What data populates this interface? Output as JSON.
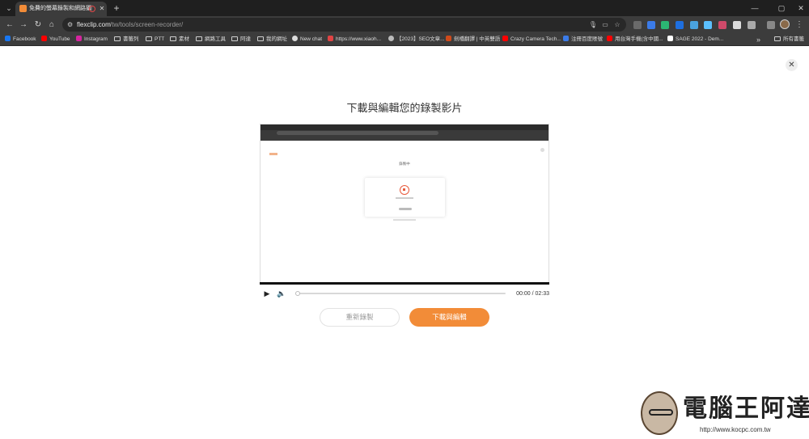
{
  "browser": {
    "tab_title": "免費的螢幕錄製和網路攝影...",
    "tab_close": "✕",
    "new_tab": "+",
    "window_controls": {
      "minimize": "—",
      "maximize": "▢",
      "close": "✕"
    },
    "nav": {
      "back": "←",
      "forward": "→",
      "reload": "↻",
      "home": "⌂"
    },
    "url_host": "flexclip.com",
    "url_path": "/tw/tools/screen-recorder/",
    "omnibox_actions": [
      "mic-icon",
      "cast-icon",
      "star-icon"
    ],
    "menu": "⋮",
    "bookmarks": [
      {
        "label": "Facebook",
        "icon": "facebook-icon",
        "color": "#1877f2"
      },
      {
        "label": "YouTube",
        "icon": "youtube-icon",
        "color": "#ff0000"
      },
      {
        "label": "Instagram",
        "icon": "instagram-icon",
        "color": "#d6249f"
      },
      {
        "label": "書籤列",
        "icon": "folder-icon"
      },
      {
        "label": "PTT",
        "icon": "folder-icon"
      },
      {
        "label": "素材",
        "icon": "folder-icon"
      },
      {
        "label": "網路工具",
        "icon": "folder-icon"
      },
      {
        "label": "阿達",
        "icon": "folder-icon"
      },
      {
        "label": "我的網址",
        "icon": "folder-icon"
      },
      {
        "label": "New chat",
        "icon": "chatgpt-icon",
        "color": "#dddddd"
      },
      {
        "label": "https://www.xiaoh...",
        "icon": "site-icon",
        "color": "#e04444"
      },
      {
        "label": "【2023】SEO文章...",
        "icon": "globe-icon",
        "color": "#bbbbbb"
      },
      {
        "label": "劍橋翻譯 | 中英雙語",
        "icon": "cambridge-icon",
        "color": "#d04a1a"
      },
      {
        "label": "Crazy Camera Tech...",
        "icon": "youtube-icon",
        "color": "#ff0000"
      },
      {
        "label": "注冊百度賬號",
        "icon": "baidu-icon",
        "color": "#3b7be8"
      },
      {
        "label": "用台灣手機(含中國...",
        "icon": "youtube-icon",
        "color": "#ff0000"
      },
      {
        "label": "SAGE 2022 - Dem...",
        "icon": "sage-icon",
        "color": "#ffffff"
      }
    ],
    "bookmarks_more": "»",
    "all_bookmarks": "所有書籤"
  },
  "modal": {
    "close": "✕",
    "title": "下載與編輯您的錄製影片",
    "preview_label": "錄製中",
    "player": {
      "play": "▶",
      "volume": "🔈",
      "time": "00:00 / 02:33",
      "progress": 0.0
    },
    "buttons": {
      "rerecord": "重新錄製",
      "download_edit": "下載與編輯"
    },
    "accent_color": "#f28c38"
  },
  "watermark": {
    "text": "電腦王阿達",
    "url": "http://www.kocpc.com.tw"
  }
}
